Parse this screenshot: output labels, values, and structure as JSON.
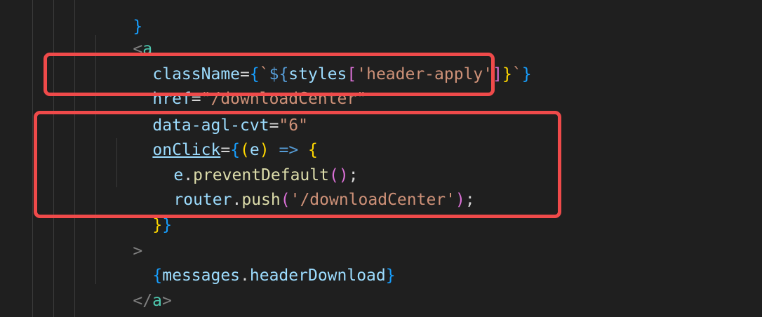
{
  "code": {
    "line0": {
      "close_brace": "}"
    },
    "line1": {
      "open": "<",
      "tag": "a"
    },
    "line2": {
      "attr": "className",
      "eq": "=",
      "b1": "{",
      "tick1": "`",
      "dollar": "${",
      "styles": "styles",
      "lb": "[",
      "str": "'header-apply'",
      "rb": "]",
      "b2": "}",
      "tick2": "`",
      "b3": "}"
    },
    "line3": {
      "attr": "href",
      "eq": "=",
      "str": "\"/downloadCenter\""
    },
    "line4": {
      "attr": "data-agl-cvt",
      "eq": "=",
      "str": "\"6\""
    },
    "line5": {
      "attr": "onClick",
      "eq": "=",
      "b1": "{",
      "p1": "(",
      "param": "e",
      "p2": ")",
      "arrow": " => ",
      "b2": "{"
    },
    "line6": {
      "obj": "e",
      "dot": ".",
      "fn": "preventDefault",
      "p1": "(",
      "p2": ")",
      "semi": ";"
    },
    "line7": {
      "obj": "router",
      "dot": ".",
      "fn": "push",
      "p1": "(",
      "str": "'/downloadCenter'",
      "p2": ")",
      "semi": ";"
    },
    "line8": {
      "b1": "}",
      "b2": "}"
    },
    "line9": {
      "gt": ">"
    },
    "line10": {
      "b1": "{",
      "obj": "messages",
      "dot": ".",
      "prop": "headerDownload",
      "b2": "}"
    },
    "line11": {
      "open": "</",
      "tag": "a",
      "close": ">"
    }
  },
  "highlight_color": "#ef4a4a"
}
